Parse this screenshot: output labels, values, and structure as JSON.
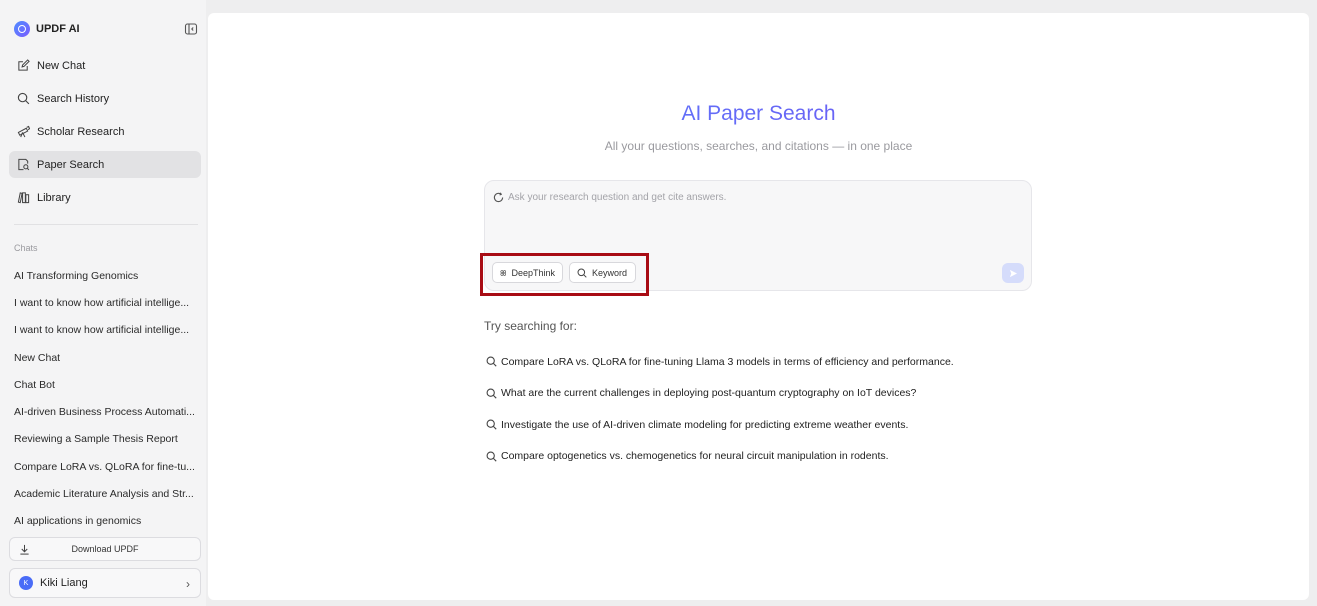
{
  "brand": {
    "name": "UPDF AI"
  },
  "nav": [
    {
      "label": "New Chat",
      "icon": "edit-icon"
    },
    {
      "label": "Search History",
      "icon": "search-icon"
    },
    {
      "label": "Scholar Research",
      "icon": "telescope-icon"
    },
    {
      "label": "Paper Search",
      "icon": "paper-search-icon",
      "active": true
    },
    {
      "label": "Library",
      "icon": "library-icon"
    }
  ],
  "chats": {
    "label": "Chats",
    "items": [
      "AI Transforming Genomics",
      "I want to know how artificial intellige...",
      "I want to know how artificial intellige...",
      "New Chat",
      "Chat Bot",
      "AI-driven Business Process Automati...",
      "Reviewing a Sample Thesis Report",
      "Compare LoRA vs. QLoRA for fine-tu...",
      "Academic Literature Analysis and Str...",
      "AI applications in genomics"
    ]
  },
  "download": {
    "label": "Download UPDF"
  },
  "user": {
    "initial": "K",
    "name": "Kiki Liang"
  },
  "main": {
    "title": "AI Paper Search",
    "subtitle": "All your questions, searches, and citations — in one place",
    "search": {
      "placeholder": "Ask your research question and get cite answers.",
      "chips": [
        "DeepThink",
        "Keyword"
      ]
    },
    "try_label": "Try searching for:",
    "suggestions": [
      "Compare LoRA vs. QLoRA for fine-tuning Llama 3 models in terms of efficiency and performance.",
      "What are the current challenges in deploying post-quantum cryptography on IoT devices?",
      "Investigate the use of AI-driven climate modeling for predicting extreme weather events.",
      "Compare optogenetics vs. chemogenetics for neural circuit manipulation in rodents."
    ]
  },
  "colors": {
    "accent": "#5b7cf6",
    "highlight": "#a80c14",
    "active_nav": "#e2e2e4"
  }
}
